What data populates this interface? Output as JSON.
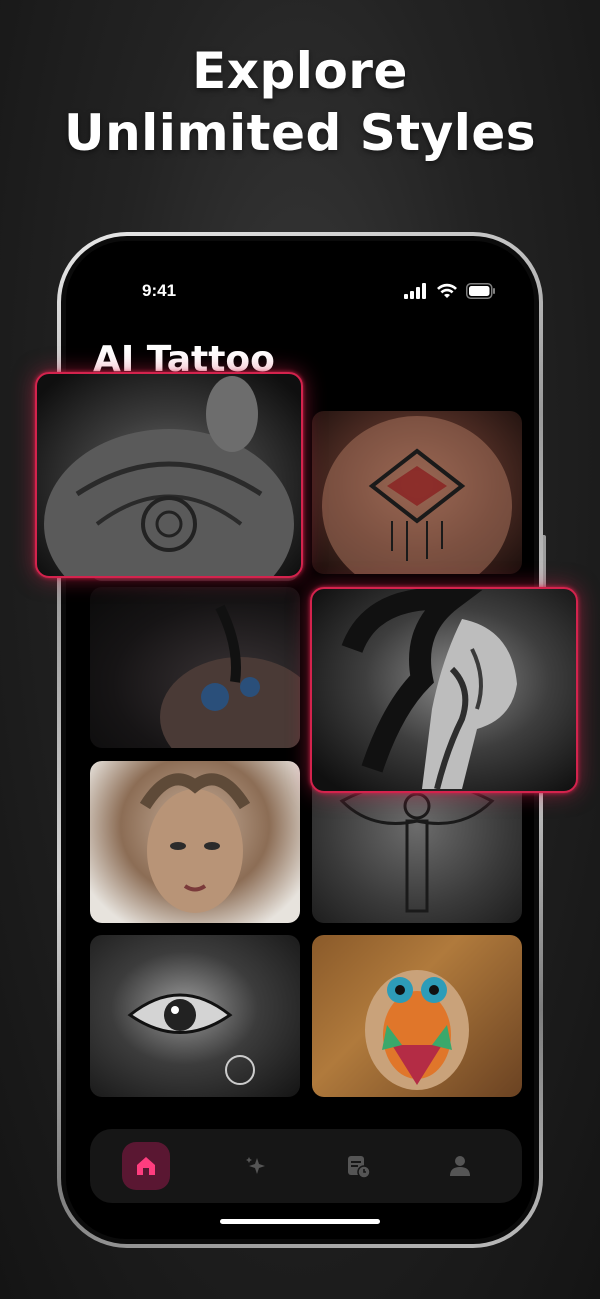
{
  "headline": {
    "line1": "Explore",
    "line2": "Unlimited Styles"
  },
  "status_bar": {
    "time": "9:41",
    "icons": [
      "signal-icon",
      "wifi-icon",
      "battery-icon"
    ]
  },
  "app": {
    "title": "AI Tattoo"
  },
  "gallery": {
    "items": [
      {
        "name": "mandala-back-tattoo",
        "highlighted": true
      },
      {
        "name": "geometric-chest-tattoo",
        "highlighted": false
      },
      {
        "name": "floral-shoulder-tattoo",
        "highlighted": false
      },
      {
        "name": "face-neck-tattoo",
        "highlighted": true
      },
      {
        "name": "medusa-arm-tattoo",
        "highlighted": false
      },
      {
        "name": "ornamental-upper-back-tattoo",
        "highlighted": false
      },
      {
        "name": "eye-forearm-tattoo",
        "highlighted": false
      },
      {
        "name": "owl-color-tattoo",
        "highlighted": false
      }
    ]
  },
  "tabbar": {
    "tabs": [
      {
        "icon": "home-icon",
        "active": true
      },
      {
        "icon": "sparkle-icon",
        "active": false
      },
      {
        "icon": "history-icon",
        "active": false
      },
      {
        "icon": "profile-icon",
        "active": false
      }
    ]
  },
  "colors": {
    "accent": "#d4234d",
    "active_tab_bg": "#5a1732",
    "active_tab_icon": "#ff3d7f",
    "background": "#000000"
  }
}
